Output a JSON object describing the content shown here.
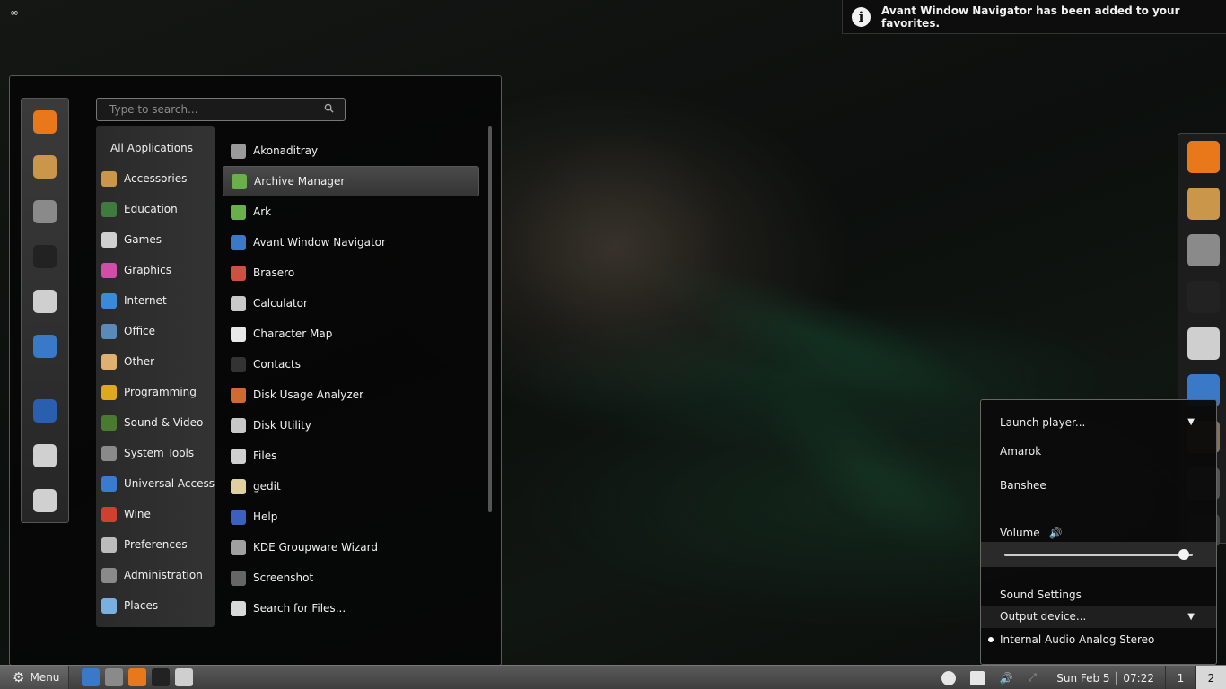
{
  "desktop": {
    "corner_icon": "∞"
  },
  "notification": {
    "icon": "info-icon",
    "text": "Avant Window Navigator has been added to your favorites."
  },
  "menu": {
    "search_placeholder": "Type to search...",
    "favorites": [
      {
        "name": "firefox",
        "color": "#e8781a"
      },
      {
        "name": "package-installer",
        "color": "#c9964a"
      },
      {
        "name": "system-settings",
        "color": "#8a8a8a"
      },
      {
        "name": "terminal",
        "color": "#222222"
      },
      {
        "name": "file-cabinet",
        "color": "#cfcfcf"
      },
      {
        "name": "window-navigator",
        "color": "#3a78c8"
      },
      {
        "name": "lock-screen",
        "color": "#2a5fb0"
      },
      {
        "name": "logout",
        "color": "#d0d0d0"
      },
      {
        "name": "shutdown",
        "color": "#d0d0d0"
      }
    ],
    "categories": [
      {
        "label": "All Applications",
        "color": ""
      },
      {
        "label": "Accessories",
        "color": "#c9964a"
      },
      {
        "label": "Education",
        "color": "#3f7a3f"
      },
      {
        "label": "Games",
        "color": "#d0d0d0"
      },
      {
        "label": "Graphics",
        "color": "#d04ea8"
      },
      {
        "label": "Internet",
        "color": "#3a8ad8"
      },
      {
        "label": "Office",
        "color": "#5a8ab8"
      },
      {
        "label": "Other",
        "color": "#e0b070"
      },
      {
        "label": "Programming",
        "color": "#e0a820"
      },
      {
        "label": "Sound & Video",
        "color": "#4a7a30"
      },
      {
        "label": "System Tools",
        "color": "#8a8a8a"
      },
      {
        "label": "Universal Access",
        "color": "#3a7ad0"
      },
      {
        "label": "Wine",
        "color": "#d04030"
      },
      {
        "label": "Preferences",
        "color": "#bcbcbc"
      },
      {
        "label": "Administration",
        "color": "#8a8a8a"
      },
      {
        "label": "Places",
        "color": "#7ab0e0"
      }
    ],
    "applications": [
      {
        "label": "Akonaditray",
        "color": "#9a9a9a"
      },
      {
        "label": "Archive Manager",
        "color": "#6ab04a",
        "selected": true
      },
      {
        "label": "Ark",
        "color": "#6ab04a"
      },
      {
        "label": "Avant Window Navigator",
        "color": "#3a78c8"
      },
      {
        "label": "Brasero",
        "color": "#d05040"
      },
      {
        "label": "Calculator",
        "color": "#c8c8c8"
      },
      {
        "label": "Character Map",
        "color": "#e8e8e8"
      },
      {
        "label": "Contacts",
        "color": "#333333"
      },
      {
        "label": "Disk Usage Analyzer",
        "color": "#d06a30"
      },
      {
        "label": "Disk Utility",
        "color": "#c8c8c8"
      },
      {
        "label": "Files",
        "color": "#d0d0d0"
      },
      {
        "label": "gedit",
        "color": "#e0d0a0"
      },
      {
        "label": "Help",
        "color": "#3a60c0"
      },
      {
        "label": "KDE Groupware Wizard",
        "color": "#a0a0a0"
      },
      {
        "label": "Screenshot",
        "color": "#666666"
      },
      {
        "label": "Search for Files...",
        "color": "#d8d8d8"
      }
    ]
  },
  "dock": {
    "items": [
      {
        "name": "firefox",
        "color": "#e8781a"
      },
      {
        "name": "package-installer",
        "color": "#c9964a"
      },
      {
        "name": "system-settings",
        "color": "#8a8a8a"
      },
      {
        "name": "terminal",
        "color": "#222222"
      },
      {
        "name": "file-cabinet",
        "color": "#cfcfcf"
      },
      {
        "name": "window-navigator",
        "color": "#3a78c8"
      },
      {
        "name": "paint",
        "color": "#8a7050"
      },
      {
        "name": "eye",
        "color": "#555555"
      },
      {
        "name": "mixer",
        "color": "#444444"
      }
    ]
  },
  "sound_menu": {
    "launch_player": "Launch player...",
    "players": [
      "Amarok",
      "Banshee"
    ],
    "volume_label": "Volume",
    "volume_level": 0.95,
    "sound_settings": "Sound Settings",
    "output_device": "Output device...",
    "output_option": "Internal Audio Analog Stereo"
  },
  "taskbar": {
    "menu_label": "Menu",
    "launchers": [
      {
        "name": "window-navigator",
        "color": "#3a78c8"
      },
      {
        "name": "system-settings",
        "color": "#8a8a8a"
      },
      {
        "name": "firefox",
        "color": "#e8781a"
      },
      {
        "name": "terminal",
        "color": "#222222"
      },
      {
        "name": "file-cabinet",
        "color": "#cfcfcf"
      }
    ],
    "clock": "Sun Feb 5 │ 07:22",
    "workspaces": [
      "1",
      "2"
    ],
    "active_workspace": "2"
  }
}
